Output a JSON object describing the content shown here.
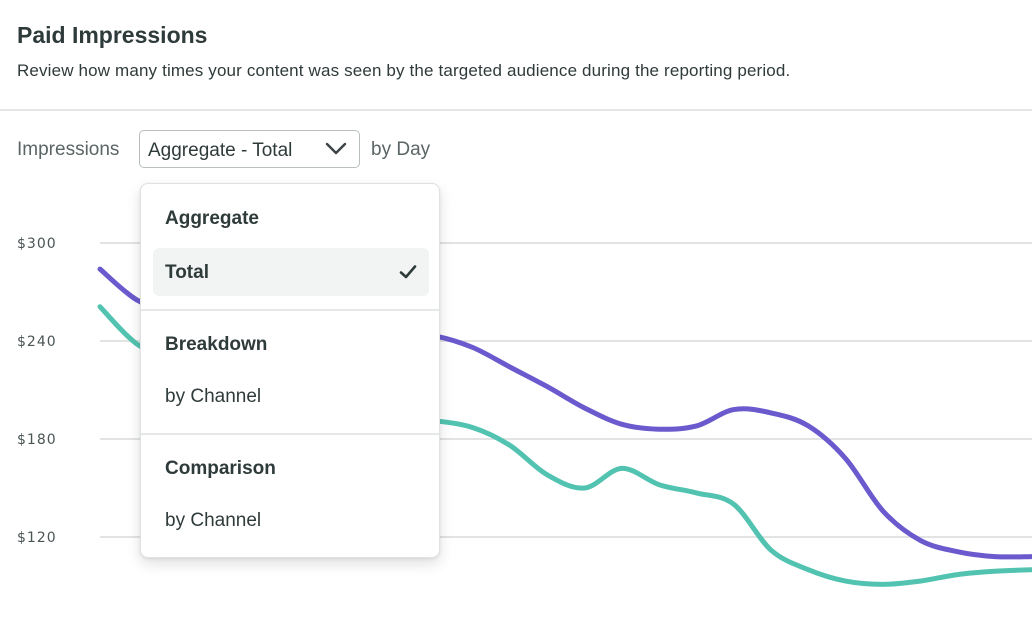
{
  "header": {
    "title": "Paid Impressions",
    "subtitle": "Review how many times your content was seen by the targeted audience during the reporting period."
  },
  "controls": {
    "metric_label": "Impressions",
    "selected_value": "Aggregate - Total",
    "suffix_label": "by Day",
    "chevron_icon": "chevron-down-icon"
  },
  "dropdown": {
    "groups": [
      {
        "title": "Aggregate",
        "options": [
          {
            "label": "Total",
            "selected": true
          }
        ]
      },
      {
        "title": "Breakdown",
        "options": [
          {
            "label": "by Channel",
            "selected": false
          }
        ]
      },
      {
        "title": "Comparison",
        "options": [
          {
            "label": "by Channel",
            "selected": false
          }
        ]
      }
    ],
    "check_icon": "check-icon"
  },
  "chart_data": {
    "type": "line",
    "y_ticks": [
      "$300",
      "$240",
      "$180",
      "$120"
    ],
    "y_tick_values": [
      300,
      240,
      180,
      120
    ],
    "ylim": [
      90,
      300
    ],
    "grid": true,
    "series": [
      {
        "color": "#6a5acd",
        "values": [
          284,
          265,
          258,
          254,
          251,
          249,
          247,
          246,
          245,
          243,
          236,
          224,
          212,
          199,
          189,
          186,
          188,
          198,
          196,
          188,
          168,
          136,
          118,
          111,
          108,
          108
        ]
      },
      {
        "color": "#52c3b0",
        "values": [
          261,
          238,
          230,
          226,
          221,
          214,
          205,
          196,
          191,
          191,
          187,
          176,
          158,
          150,
          162,
          152,
          147,
          140,
          112,
          100,
          93,
          91,
          93,
          97,
          99,
          100
        ]
      }
    ]
  }
}
